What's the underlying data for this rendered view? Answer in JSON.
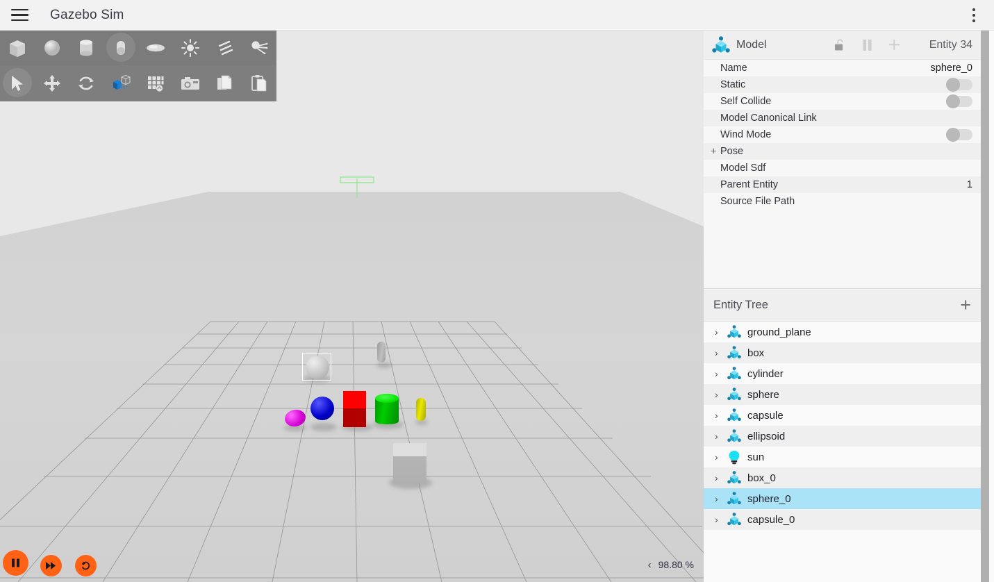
{
  "titlebar": {
    "app_title": "Gazebo Sim",
    "menu_icon": "hamburger-menu-icon",
    "overflow_icon": "kebab-menu-icon"
  },
  "toolbar_shapes": [
    {
      "name": "box",
      "label": "Box",
      "active": false
    },
    {
      "name": "sphere",
      "label": "Sphere",
      "active": false
    },
    {
      "name": "cylinder",
      "label": "Cylinder",
      "active": false
    },
    {
      "name": "capsule",
      "label": "Capsule",
      "active": true
    },
    {
      "name": "ellipsoid",
      "label": "Ellipsoid",
      "active": false
    },
    {
      "name": "point-light",
      "label": "Point Light",
      "active": false
    },
    {
      "name": "directional-light",
      "label": "Directional Light",
      "active": false
    },
    {
      "name": "spot-light",
      "label": "Spot Light",
      "active": false
    }
  ],
  "toolbar_tools": [
    {
      "name": "select",
      "label": "Select",
      "active": true
    },
    {
      "name": "translate",
      "label": "Translate",
      "active": false
    },
    {
      "name": "rotate",
      "label": "Rotate",
      "active": false
    },
    {
      "name": "transform-snap",
      "label": "Snap to Grid",
      "active": false
    },
    {
      "name": "grid",
      "label": "Grid",
      "active": false
    },
    {
      "name": "screenshot",
      "label": "Screenshot",
      "active": false
    },
    {
      "name": "copy",
      "label": "Copy",
      "active": false
    },
    {
      "name": "paste",
      "label": "Paste",
      "active": false
    }
  ],
  "playback": {
    "pause_label": "Pause",
    "step_label": "Step",
    "reset_label": "Reset"
  },
  "viewport_status": {
    "chevron": "‹",
    "real_time_factor": "98.80 %"
  },
  "scene": {
    "sky_color": "#e8e8e8",
    "ground_color": "#d3d3d3",
    "sun_marker_color": "#8ee88e",
    "objects": [
      {
        "name": "ellipsoid-magenta",
        "color": "#d400d4"
      },
      {
        "name": "sphere-blue",
        "color": "#0000c8"
      },
      {
        "name": "box-red",
        "color": "#ff0000"
      },
      {
        "name": "cylinder-green",
        "color": "#00cc00"
      },
      {
        "name": "capsule-yellow",
        "color": "#d8d800"
      },
      {
        "name": "box-white",
        "color": "#d8d8d8"
      },
      {
        "name": "sphere-white-selected",
        "color": "#bdbdbd"
      },
      {
        "name": "capsule-gray-far",
        "color": "#a8a8a8"
      }
    ]
  },
  "model_panel": {
    "title": "Model",
    "icon": "model-node-icon",
    "entity_label": "Entity 34",
    "lock_icon": "unlock-icon",
    "pause_icon": "pause-icon",
    "add_icon": "plus-icon",
    "properties": [
      {
        "name": "Name",
        "value": "sphere_0",
        "type": "text"
      },
      {
        "name": "Static",
        "value": "",
        "type": "toggle",
        "checked": false
      },
      {
        "name": "Self Collide",
        "value": "",
        "type": "toggle",
        "checked": false
      },
      {
        "name": "Model Canonical Link",
        "value": "",
        "type": "text"
      },
      {
        "name": "Wind Mode",
        "value": "",
        "type": "toggle",
        "checked": false
      },
      {
        "name": "Pose",
        "value": "",
        "type": "expander",
        "expander": "+"
      },
      {
        "name": "Model Sdf",
        "value": "",
        "type": "text"
      },
      {
        "name": "Parent Entity",
        "value": "1",
        "type": "text"
      },
      {
        "name": "Source File Path",
        "value": "",
        "type": "text"
      }
    ]
  },
  "entity_tree": {
    "title": "Entity Tree",
    "add_label": "+",
    "items": [
      {
        "label": "ground_plane",
        "icon": "model-node-icon",
        "selected": false
      },
      {
        "label": "box",
        "icon": "model-node-icon",
        "selected": false
      },
      {
        "label": "cylinder",
        "icon": "model-node-icon",
        "selected": false
      },
      {
        "label": "sphere",
        "icon": "model-node-icon",
        "selected": false
      },
      {
        "label": "capsule",
        "icon": "model-node-icon",
        "selected": false
      },
      {
        "label": "ellipsoid",
        "icon": "model-node-icon",
        "selected": false
      },
      {
        "label": "sun",
        "icon": "light-bulb-icon",
        "selected": false
      },
      {
        "label": "box_0",
        "icon": "model-node-icon",
        "selected": false
      },
      {
        "label": "sphere_0",
        "icon": "model-node-icon",
        "selected": true
      },
      {
        "label": "capsule_0",
        "icon": "model-node-icon",
        "selected": false
      }
    ]
  },
  "colors": {
    "accent_orange": "#ff6115",
    "selection_blue": "#aae3f8",
    "toolbar_gray": "#7b7b7b",
    "model_icon_cyan": "#2ec6e6",
    "model_icon_blue": "#1a7fa8"
  }
}
